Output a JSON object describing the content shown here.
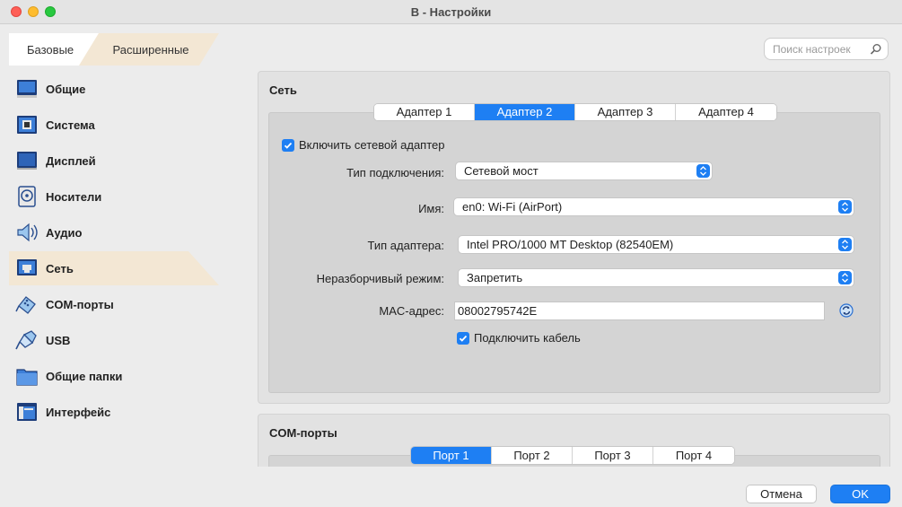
{
  "window": {
    "title": "В - Настройки"
  },
  "mode": {
    "basic": "Базовые",
    "advanced": "Расширенные"
  },
  "search": {
    "placeholder": "Поиск настроек"
  },
  "sidebar": {
    "items": [
      {
        "label": "Общие",
        "icon": "general-icon"
      },
      {
        "label": "Система",
        "icon": "system-icon"
      },
      {
        "label": "Дисплей",
        "icon": "display-icon"
      },
      {
        "label": "Носители",
        "icon": "storage-icon"
      },
      {
        "label": "Аудио",
        "icon": "audio-icon"
      },
      {
        "label": "Сеть",
        "icon": "network-icon",
        "selected": true
      },
      {
        "label": "COM-порты",
        "icon": "serial-ports-icon"
      },
      {
        "label": "USB",
        "icon": "usb-icon"
      },
      {
        "label": "Общие папки",
        "icon": "shared-folders-icon"
      },
      {
        "label": "Интерфейс",
        "icon": "user-interface-icon"
      }
    ]
  },
  "network": {
    "title": "Сеть",
    "tabs": [
      "Адаптер 1",
      "Адаптер 2",
      "Адаптер 3",
      "Адаптер 4"
    ],
    "active_tab": "Адаптер 2",
    "enable_adapter_label": "Включить сетевой адаптер",
    "enable_adapter_checked": true,
    "attached_to_label": "Тип подключения:",
    "attached_to_value": "Сетевой мост",
    "name_label": "Имя:",
    "name_value": "en0: Wi-Fi (AirPort)",
    "adapter_type_label": "Тип адаптера:",
    "adapter_type_value": "Intel PRO/1000 MT Desktop (82540EM)",
    "promiscuous_label": "Неразборчивый режим:",
    "promiscuous_value": "Запретить",
    "mac_label": "MAC-адрес:",
    "mac_value": "08002795742E",
    "cable_label": "Подключить кабель",
    "cable_checked": true
  },
  "com_ports": {
    "title": "COM-порты",
    "tabs": [
      "Порт 1",
      "Порт 2",
      "Порт 3",
      "Порт 4"
    ],
    "active_tab": "Порт 1"
  },
  "footer": {
    "cancel": "Отмена",
    "ok": "OK"
  },
  "colors": {
    "accent": "#1e7ff3",
    "selection": "#f3e7d4"
  }
}
